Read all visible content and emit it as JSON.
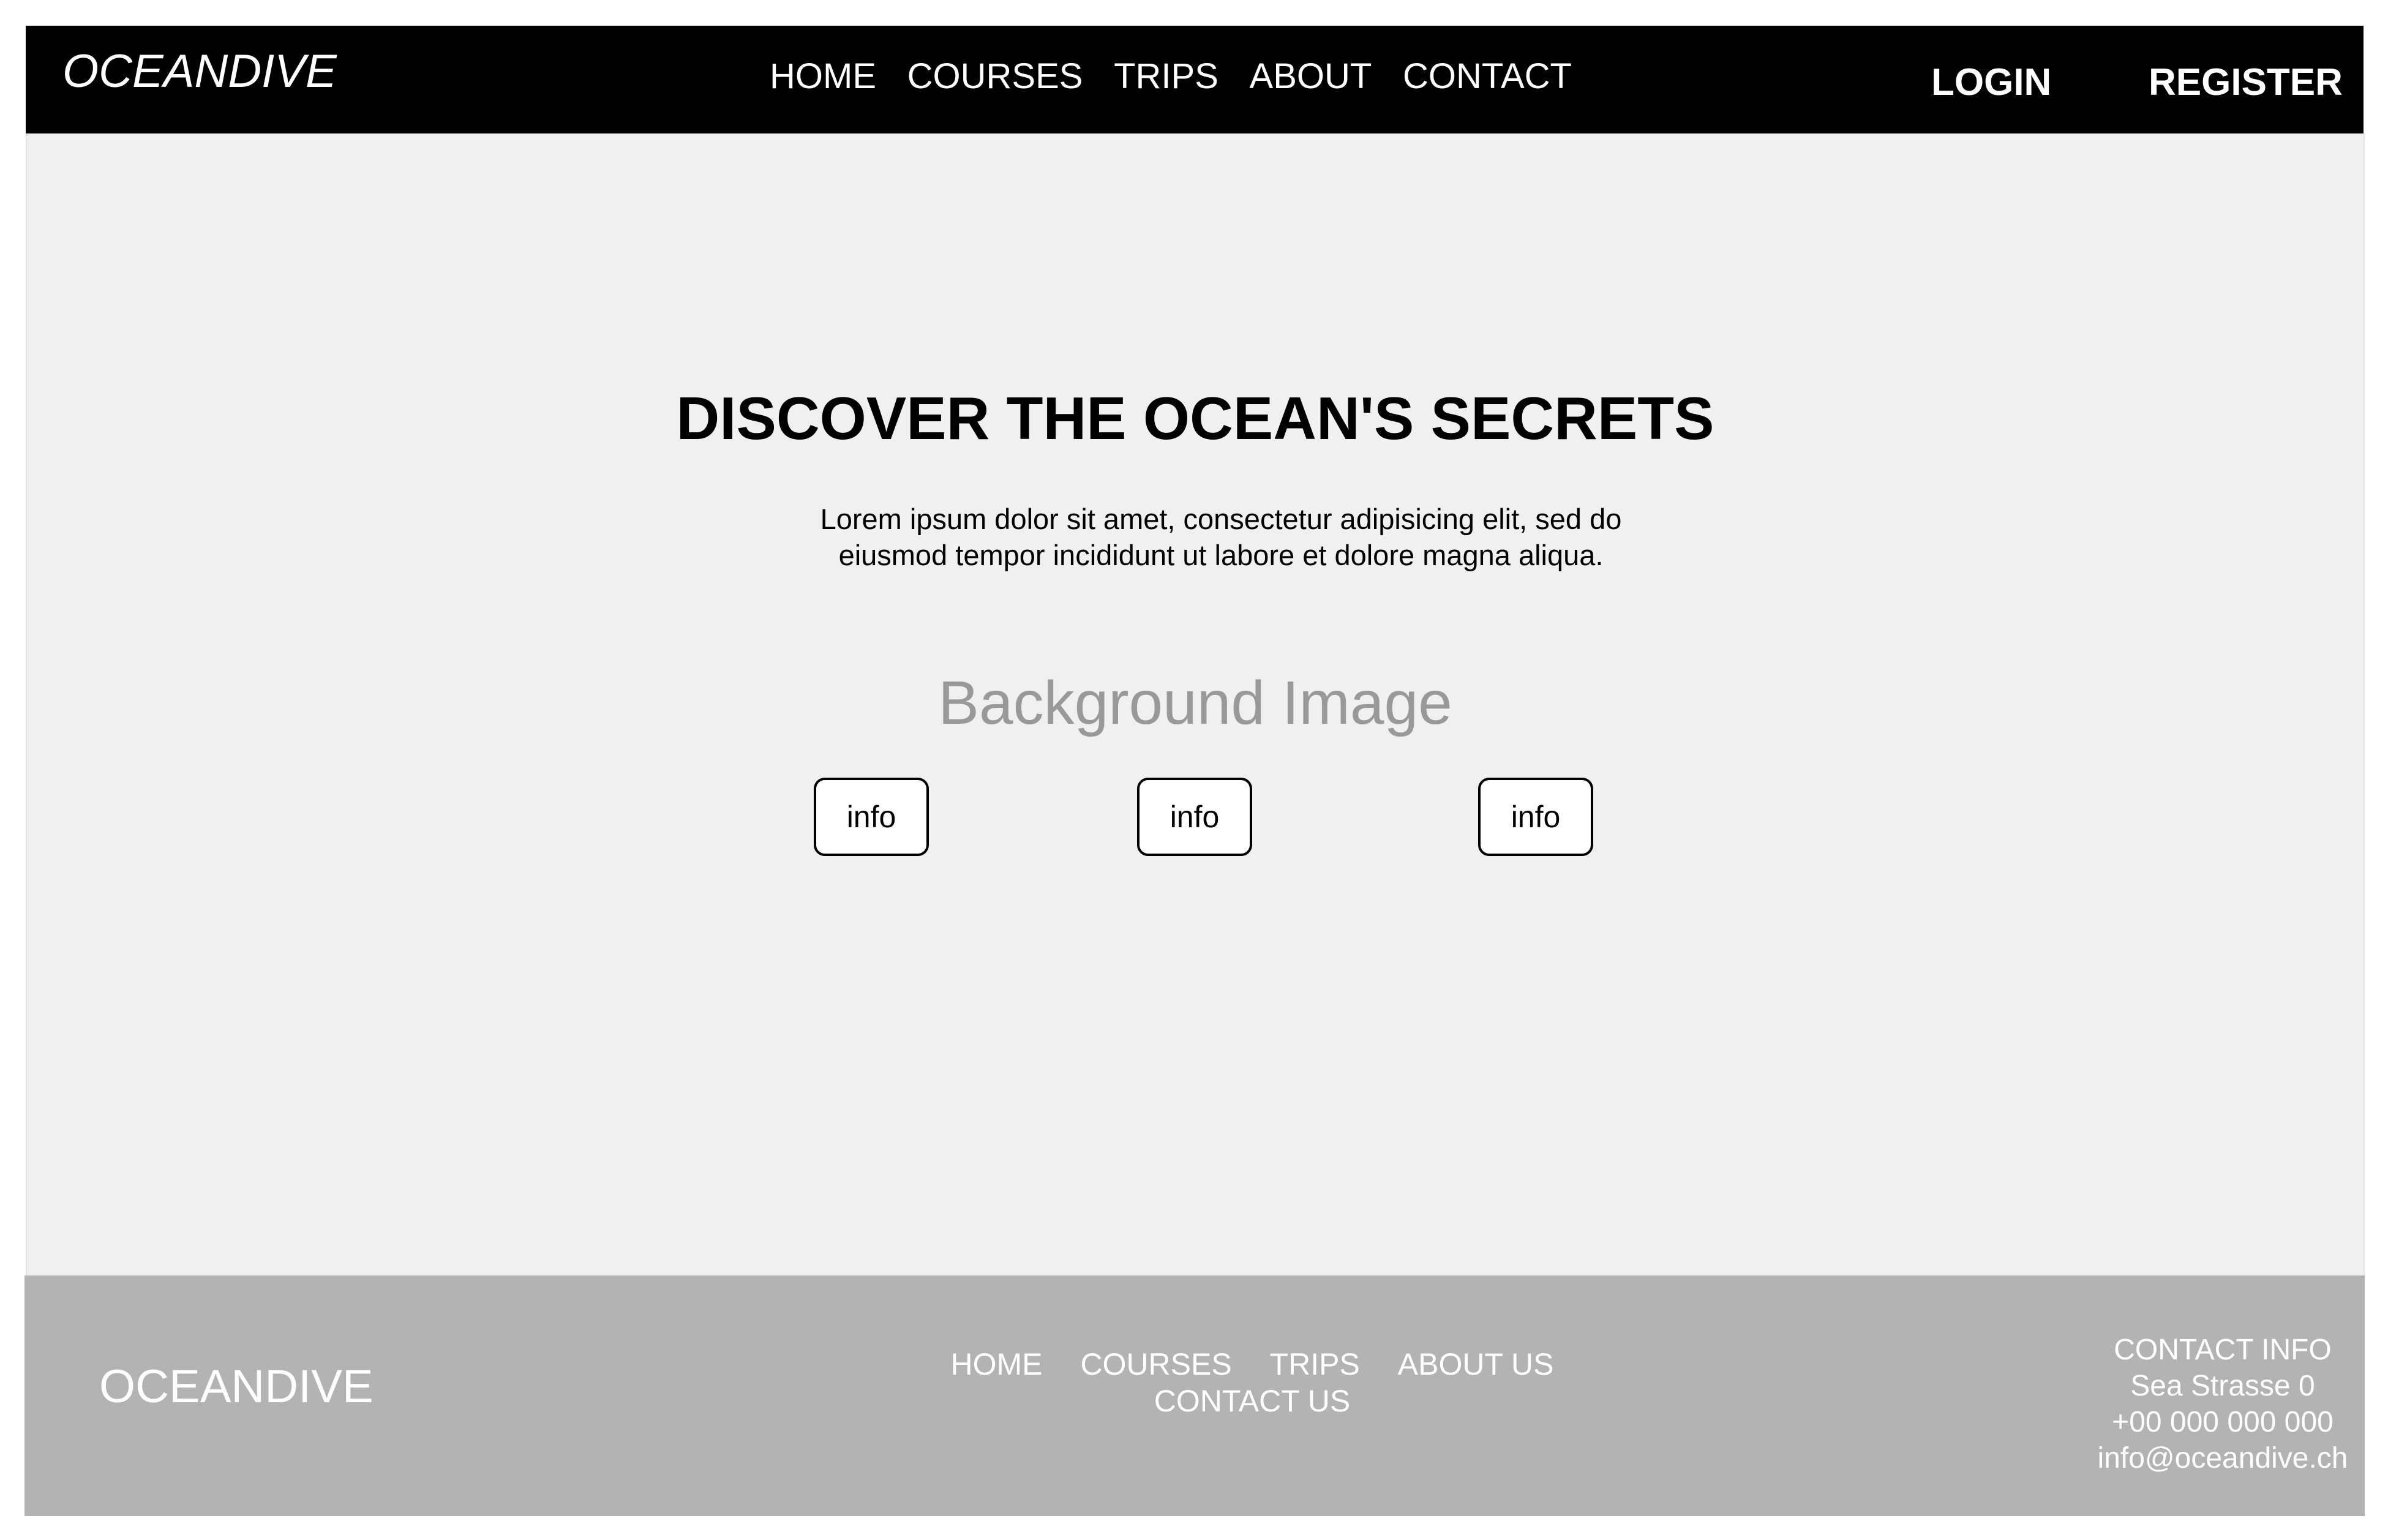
{
  "header": {
    "logo": "OCEANDIVE",
    "nav": [
      "HOME",
      "COURSES",
      "TRIPS",
      "ABOUT",
      "CONTACT"
    ],
    "login": "LOGIN",
    "register": "REGISTER"
  },
  "hero": {
    "title": "DISCOVER THE OCEAN'S SECRETS",
    "text": "Lorem ipsum dolor sit amet, consectetur adipisicing elit, sed do eiusmod tempor incididunt ut labore et dolore magna aliqua.",
    "background_label": "Background Image",
    "info_buttons": [
      "info",
      "info",
      "info"
    ]
  },
  "footer": {
    "logo": "OCEANDIVE",
    "links": [
      "HOME",
      "COURSES",
      "TRIPS",
      "ABOUT US",
      "CONTACT US"
    ],
    "contact": {
      "title": "CONTACT INFO",
      "address": "Sea Strasse 0",
      "phone": "+00 000 000 000",
      "email": "info@oceandive.ch"
    }
  },
  "colors": {
    "header_bg": "#000000",
    "hero_bg": "#f0f0f0",
    "footer_bg": "#b3b3b3",
    "placeholder_text": "#999999"
  }
}
